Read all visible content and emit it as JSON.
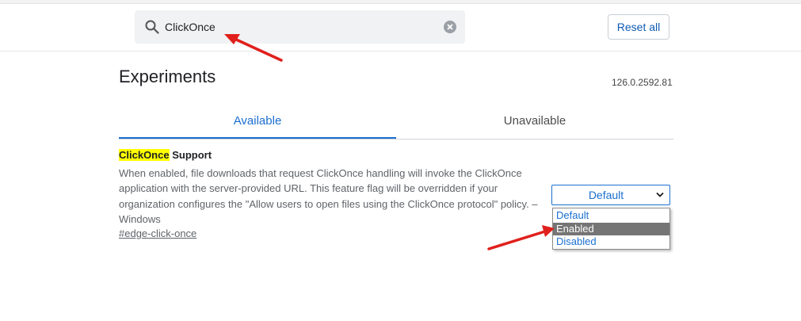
{
  "search": {
    "value": "ClickOnce",
    "placeholder": "Search flags"
  },
  "header": {
    "reset_label": "Reset all"
  },
  "page": {
    "title": "Experiments",
    "version": "126.0.2592.81"
  },
  "tabs": [
    {
      "label": "Available",
      "active": true
    },
    {
      "label": "Unavailable",
      "active": false
    }
  ],
  "flag": {
    "title_highlight": "ClickOnce",
    "title_rest": " Support",
    "description": "When enabled, file downloads that request ClickOnce handling will invoke the ClickOnce application with the server-provided URL. This feature flag will be overridden if your organization configures the \"Allow users to open files using the ClickOnce protocol\" policy. – Windows",
    "link": "#edge-click-once",
    "selected": "Default",
    "options": [
      "Default",
      "Enabled",
      "Disabled"
    ],
    "hovered_option": "Enabled"
  },
  "colors": {
    "accent": "#1a6fd0",
    "highlight": "#ffff00",
    "annotation_arrow": "#e0201c",
    "hover_option": "#757575"
  },
  "icons": {
    "search": "search-icon",
    "clear": "clear-icon",
    "chevron": "chevron-down-icon"
  }
}
